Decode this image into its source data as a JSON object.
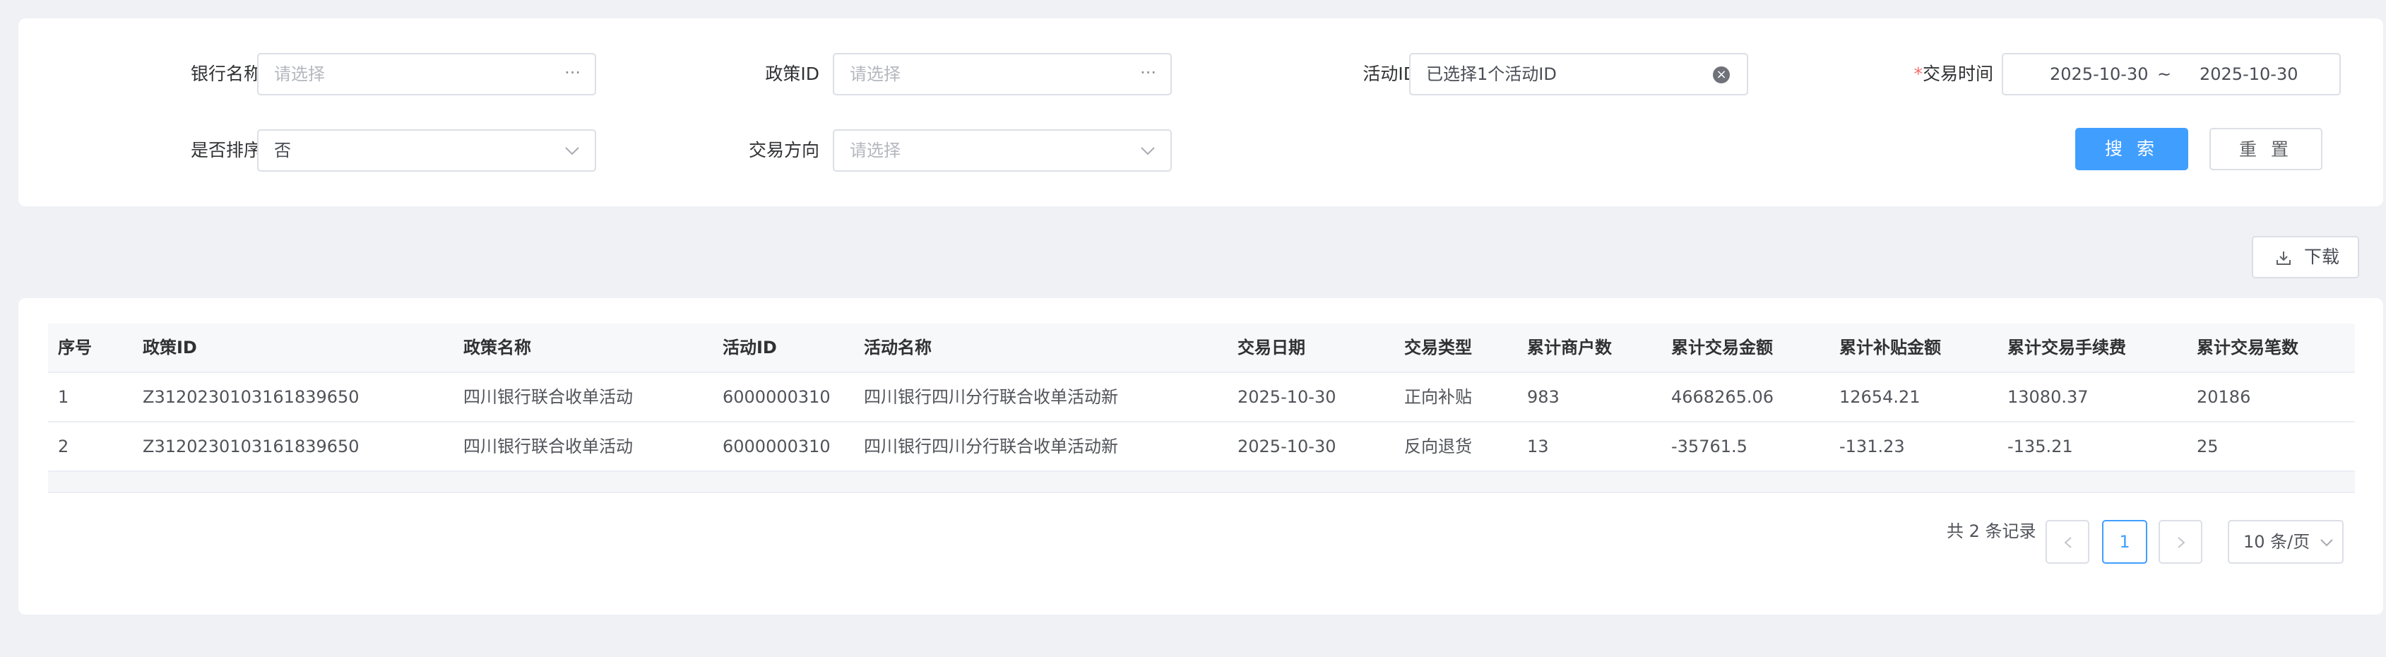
{
  "filters": {
    "bank_name": {
      "label": "银行名称",
      "placeholder": "请选择",
      "suffix": "···"
    },
    "policy_id": {
      "label": "政策ID",
      "placeholder": "请选择",
      "suffix": "···"
    },
    "activity_id": {
      "label": "活动ID",
      "value": "已选择1个活动ID"
    },
    "trade_time": {
      "required_mark": "*",
      "label": "交易时间",
      "start": "2025-10-30",
      "separator": "~",
      "end": "2025-10-30"
    },
    "sort": {
      "label": "是否排序",
      "value": "否"
    },
    "direction": {
      "label": "交易方向",
      "placeholder": "请选择"
    }
  },
  "actions": {
    "search_label": "搜 索",
    "reset_label": "重 置",
    "download_label": "下载"
  },
  "table": {
    "columns": [
      "序号",
      "政策ID",
      "政策名称",
      "活动ID",
      "活动名称",
      "交易日期",
      "交易类型",
      "累计商户数",
      "累计交易金额",
      "累计补贴金额",
      "累计交易手续费",
      "累计交易笔数"
    ],
    "rows": [
      [
        "1",
        "Z3120230103161839650",
        "四川银行联合收单活动",
        "6000000310",
        "四川银行四川分行联合收单活动新",
        "2025-10-30",
        "正向补贴",
        "983",
        "4668265.06",
        "12654.21",
        "13080.37",
        "20186"
      ],
      [
        "2",
        "Z3120230103161839650",
        "四川银行联合收单活动",
        "6000000310",
        "四川银行四川分行联合收单活动新",
        "2025-10-30",
        "反向退货",
        "13",
        "-35761.5",
        "-131.23",
        "-135.21",
        "25"
      ]
    ]
  },
  "pagination": {
    "total_text": "共 2 条记录",
    "current_page": "1",
    "page_size": "10 条/页"
  },
  "colors": {
    "primary": "#409eff",
    "required": "#f56c6c",
    "background": "#f0f1f5"
  },
  "icons": {
    "download": "download-icon",
    "prev": "chevron-left-icon",
    "next": "chevron-right-icon",
    "dropdown": "chevron-down-icon",
    "clear": "clear-circle-icon"
  }
}
